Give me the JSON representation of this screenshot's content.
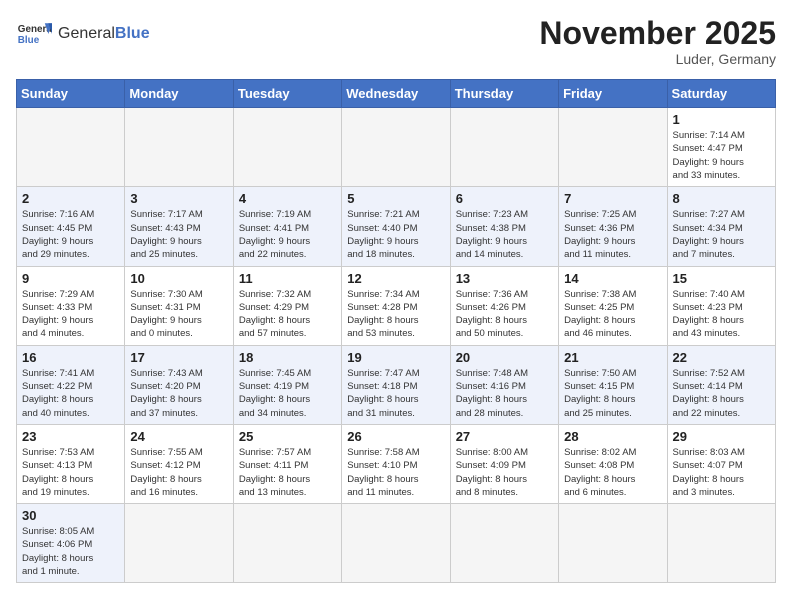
{
  "logo": {
    "text_general": "General",
    "text_blue": "Blue"
  },
  "title": "November 2025",
  "location": "Luder, Germany",
  "days_of_week": [
    "Sunday",
    "Monday",
    "Tuesday",
    "Wednesday",
    "Thursday",
    "Friday",
    "Saturday"
  ],
  "weeks": [
    [
      {
        "day": "",
        "info": ""
      },
      {
        "day": "",
        "info": ""
      },
      {
        "day": "",
        "info": ""
      },
      {
        "day": "",
        "info": ""
      },
      {
        "day": "",
        "info": ""
      },
      {
        "day": "",
        "info": ""
      },
      {
        "day": "1",
        "info": "Sunrise: 7:14 AM\nSunset: 4:47 PM\nDaylight: 9 hours\nand 33 minutes."
      }
    ],
    [
      {
        "day": "2",
        "info": "Sunrise: 7:16 AM\nSunset: 4:45 PM\nDaylight: 9 hours\nand 29 minutes."
      },
      {
        "day": "3",
        "info": "Sunrise: 7:17 AM\nSunset: 4:43 PM\nDaylight: 9 hours\nand 25 minutes."
      },
      {
        "day": "4",
        "info": "Sunrise: 7:19 AM\nSunset: 4:41 PM\nDaylight: 9 hours\nand 22 minutes."
      },
      {
        "day": "5",
        "info": "Sunrise: 7:21 AM\nSunset: 4:40 PM\nDaylight: 9 hours\nand 18 minutes."
      },
      {
        "day": "6",
        "info": "Sunrise: 7:23 AM\nSunset: 4:38 PM\nDaylight: 9 hours\nand 14 minutes."
      },
      {
        "day": "7",
        "info": "Sunrise: 7:25 AM\nSunset: 4:36 PM\nDaylight: 9 hours\nand 11 minutes."
      },
      {
        "day": "8",
        "info": "Sunrise: 7:27 AM\nSunset: 4:34 PM\nDaylight: 9 hours\nand 7 minutes."
      }
    ],
    [
      {
        "day": "9",
        "info": "Sunrise: 7:29 AM\nSunset: 4:33 PM\nDaylight: 9 hours\nand 4 minutes."
      },
      {
        "day": "10",
        "info": "Sunrise: 7:30 AM\nSunset: 4:31 PM\nDaylight: 9 hours\nand 0 minutes."
      },
      {
        "day": "11",
        "info": "Sunrise: 7:32 AM\nSunset: 4:29 PM\nDaylight: 8 hours\nand 57 minutes."
      },
      {
        "day": "12",
        "info": "Sunrise: 7:34 AM\nSunset: 4:28 PM\nDaylight: 8 hours\nand 53 minutes."
      },
      {
        "day": "13",
        "info": "Sunrise: 7:36 AM\nSunset: 4:26 PM\nDaylight: 8 hours\nand 50 minutes."
      },
      {
        "day": "14",
        "info": "Sunrise: 7:38 AM\nSunset: 4:25 PM\nDaylight: 8 hours\nand 46 minutes."
      },
      {
        "day": "15",
        "info": "Sunrise: 7:40 AM\nSunset: 4:23 PM\nDaylight: 8 hours\nand 43 minutes."
      }
    ],
    [
      {
        "day": "16",
        "info": "Sunrise: 7:41 AM\nSunset: 4:22 PM\nDaylight: 8 hours\nand 40 minutes."
      },
      {
        "day": "17",
        "info": "Sunrise: 7:43 AM\nSunset: 4:20 PM\nDaylight: 8 hours\nand 37 minutes."
      },
      {
        "day": "18",
        "info": "Sunrise: 7:45 AM\nSunset: 4:19 PM\nDaylight: 8 hours\nand 34 minutes."
      },
      {
        "day": "19",
        "info": "Sunrise: 7:47 AM\nSunset: 4:18 PM\nDaylight: 8 hours\nand 31 minutes."
      },
      {
        "day": "20",
        "info": "Sunrise: 7:48 AM\nSunset: 4:16 PM\nDaylight: 8 hours\nand 28 minutes."
      },
      {
        "day": "21",
        "info": "Sunrise: 7:50 AM\nSunset: 4:15 PM\nDaylight: 8 hours\nand 25 minutes."
      },
      {
        "day": "22",
        "info": "Sunrise: 7:52 AM\nSunset: 4:14 PM\nDaylight: 8 hours\nand 22 minutes."
      }
    ],
    [
      {
        "day": "23",
        "info": "Sunrise: 7:53 AM\nSunset: 4:13 PM\nDaylight: 8 hours\nand 19 minutes."
      },
      {
        "day": "24",
        "info": "Sunrise: 7:55 AM\nSunset: 4:12 PM\nDaylight: 8 hours\nand 16 minutes."
      },
      {
        "day": "25",
        "info": "Sunrise: 7:57 AM\nSunset: 4:11 PM\nDaylight: 8 hours\nand 13 minutes."
      },
      {
        "day": "26",
        "info": "Sunrise: 7:58 AM\nSunset: 4:10 PM\nDaylight: 8 hours\nand 11 minutes."
      },
      {
        "day": "27",
        "info": "Sunrise: 8:00 AM\nSunset: 4:09 PM\nDaylight: 8 hours\nand 8 minutes."
      },
      {
        "day": "28",
        "info": "Sunrise: 8:02 AM\nSunset: 4:08 PM\nDaylight: 8 hours\nand 6 minutes."
      },
      {
        "day": "29",
        "info": "Sunrise: 8:03 AM\nSunset: 4:07 PM\nDaylight: 8 hours\nand 3 minutes."
      }
    ],
    [
      {
        "day": "30",
        "info": "Sunrise: 8:05 AM\nSunset: 4:06 PM\nDaylight: 8 hours\nand 1 minute."
      },
      {
        "day": "",
        "info": ""
      },
      {
        "day": "",
        "info": ""
      },
      {
        "day": "",
        "info": ""
      },
      {
        "day": "",
        "info": ""
      },
      {
        "day": "",
        "info": ""
      },
      {
        "day": "",
        "info": ""
      }
    ]
  ]
}
